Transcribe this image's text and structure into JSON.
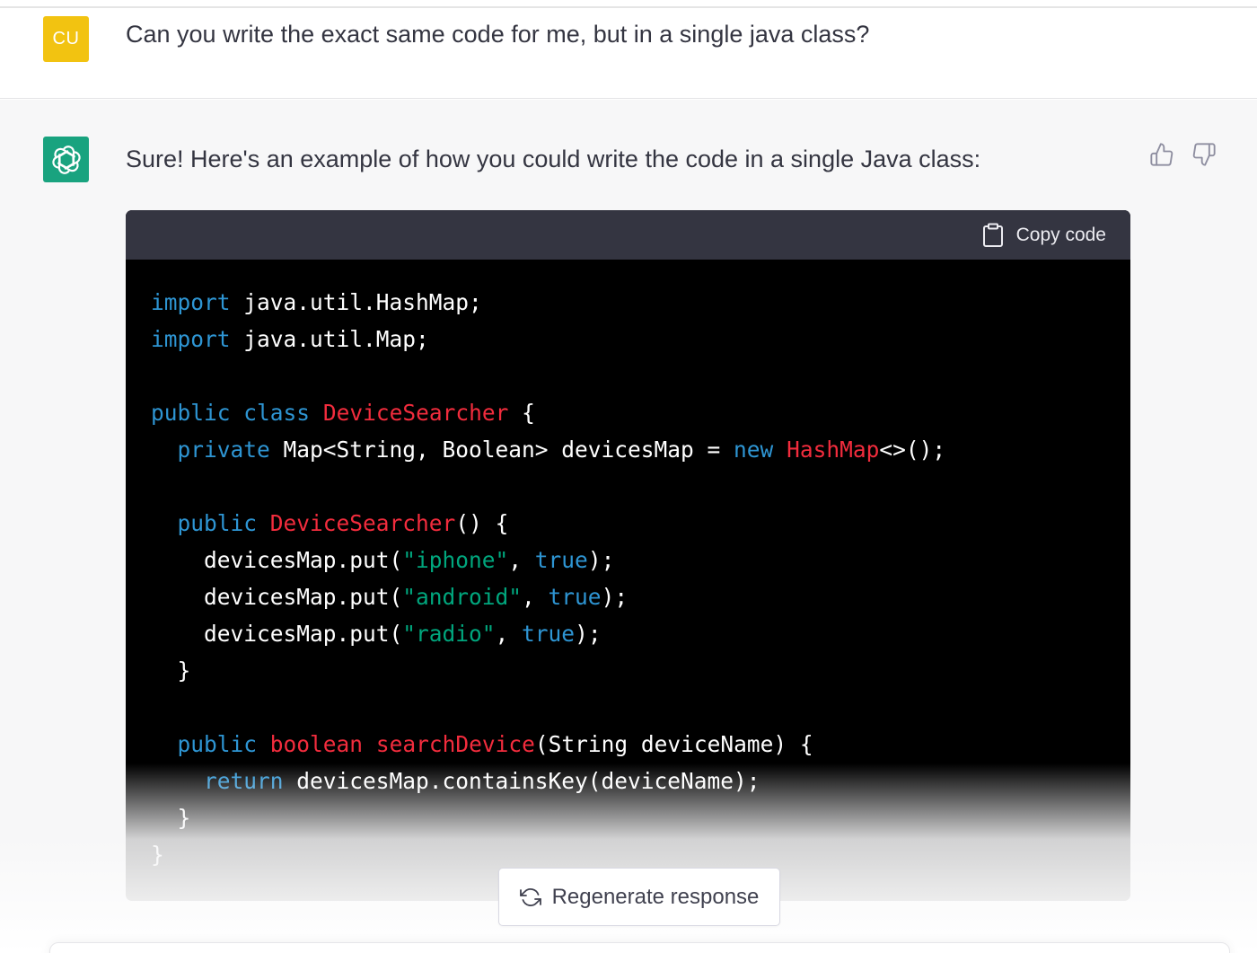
{
  "user_message": {
    "avatar_initials": "CU",
    "text": "Can you write the exact same code for me, but in a single java class?"
  },
  "assistant_message": {
    "text": "Sure! Here's an example of how you could write the code in a single Java class:",
    "copy_label": "Copy code"
  },
  "code_lines": [
    [
      {
        "t": "import",
        "c": "kw"
      },
      {
        "t": " java.util.HashMap;",
        "c": ""
      }
    ],
    [
      {
        "t": "import",
        "c": "kw"
      },
      {
        "t": " java.util.Map;",
        "c": ""
      }
    ],
    [],
    [
      {
        "t": "public",
        "c": "kw"
      },
      {
        "t": " ",
        "c": ""
      },
      {
        "t": "class",
        "c": "kw"
      },
      {
        "t": " ",
        "c": ""
      },
      {
        "t": "DeviceSearcher",
        "c": "ty"
      },
      {
        "t": " {",
        "c": ""
      }
    ],
    [
      {
        "t": "  ",
        "c": ""
      },
      {
        "t": "private",
        "c": "kw"
      },
      {
        "t": " Map<String, Boolean> devicesMap = ",
        "c": ""
      },
      {
        "t": "new",
        "c": "kw"
      },
      {
        "t": " ",
        "c": ""
      },
      {
        "t": "HashMap",
        "c": "ty"
      },
      {
        "t": "<>();",
        "c": ""
      }
    ],
    [],
    [
      {
        "t": "  ",
        "c": ""
      },
      {
        "t": "public",
        "c": "kw"
      },
      {
        "t": " ",
        "c": ""
      },
      {
        "t": "DeviceSearcher",
        "c": "ty"
      },
      {
        "t": "() {",
        "c": ""
      }
    ],
    [
      {
        "t": "    devicesMap.put(",
        "c": ""
      },
      {
        "t": "\"iphone\"",
        "c": "st"
      },
      {
        "t": ", ",
        "c": ""
      },
      {
        "t": "true",
        "c": "kw"
      },
      {
        "t": ");",
        "c": ""
      }
    ],
    [
      {
        "t": "    devicesMap.put(",
        "c": ""
      },
      {
        "t": "\"android\"",
        "c": "st"
      },
      {
        "t": ", ",
        "c": ""
      },
      {
        "t": "true",
        "c": "kw"
      },
      {
        "t": ");",
        "c": ""
      }
    ],
    [
      {
        "t": "    devicesMap.put(",
        "c": ""
      },
      {
        "t": "\"radio\"",
        "c": "st"
      },
      {
        "t": ", ",
        "c": ""
      },
      {
        "t": "true",
        "c": "kw"
      },
      {
        "t": ");",
        "c": ""
      }
    ],
    [
      {
        "t": "  }",
        "c": ""
      }
    ],
    [],
    [
      {
        "t": "  ",
        "c": ""
      },
      {
        "t": "public",
        "c": "kw"
      },
      {
        "t": " ",
        "c": ""
      },
      {
        "t": "boolean",
        "c": "ty"
      },
      {
        "t": " ",
        "c": ""
      },
      {
        "t": "searchDevice",
        "c": "ty"
      },
      {
        "t": "(String deviceName) {",
        "c": ""
      }
    ],
    [
      {
        "t": "    ",
        "c": ""
      },
      {
        "t": "return",
        "c": "kw"
      },
      {
        "t": " devicesMap.containsKey(deviceName);",
        "c": ""
      }
    ],
    [
      {
        "t": "  }",
        "c": ""
      }
    ],
    [
      {
        "t": "}",
        "c": ""
      }
    ]
  ],
  "regenerate_label": "Regenerate response",
  "icons": {
    "user_avatar": "user-avatar",
    "assistant_avatar": "openai-logo-icon",
    "thumbs_up": "thumbs-up-icon",
    "thumbs_down": "thumbs-down-icon",
    "copy": "clipboard-icon",
    "regenerate": "refresh-icon"
  },
  "colors": {
    "user_avatar_bg": "#f2c311",
    "assistant_avatar_bg": "#19a37f",
    "keyword": "#2e95d3",
    "type_name": "#f22c3d",
    "string": "#00a67d",
    "code_bg": "#000000",
    "code_header_bg": "#343541"
  }
}
